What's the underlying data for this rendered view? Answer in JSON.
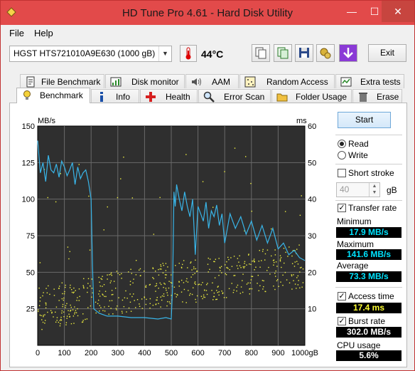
{
  "window": {
    "title": "HD Tune Pro 4.61 - Hard Disk Utility",
    "minimize": "—",
    "maximize": "☐",
    "close": "✕"
  },
  "menu": {
    "file": "File",
    "help": "Help"
  },
  "toolbar": {
    "drive": "HGST HTS721010A9E630 (1000 gB)",
    "temperature": "44°C",
    "exit_label": "Exit"
  },
  "tabs_top": [
    {
      "label": "File Benchmark",
      "icon": "file-benchmark-icon"
    },
    {
      "label": "Disk monitor",
      "icon": "disk-monitor-icon"
    },
    {
      "label": "AAM",
      "icon": "speaker-icon"
    },
    {
      "label": "Random Access",
      "icon": "random-access-icon"
    },
    {
      "label": "Extra tests",
      "icon": "extra-tests-icon"
    }
  ],
  "tabs_bottom": [
    {
      "label": "Benchmark",
      "icon": "bulb-icon",
      "active": true
    },
    {
      "label": "Info",
      "icon": "info-icon"
    },
    {
      "label": "Health",
      "icon": "health-cross-icon"
    },
    {
      "label": "Error Scan",
      "icon": "magnifier-icon"
    },
    {
      "label": "Folder Usage",
      "icon": "folder-icon"
    },
    {
      "label": "Erase",
      "icon": "trash-icon"
    }
  ],
  "controls": {
    "start_label": "Start",
    "read_label": "Read",
    "write_label": "Write",
    "read_selected": true,
    "short_stroke_label": "Short stroke",
    "short_stroke_checked": false,
    "short_stroke_value": "40",
    "short_stroke_unit": "gB",
    "transfer_rate_label": "Transfer rate",
    "transfer_rate_checked": true,
    "access_time_label": "Access time",
    "access_time_checked": true,
    "burst_rate_label": "Burst rate",
    "burst_rate_checked": true
  },
  "stats": {
    "minimum_label": "Minimum",
    "minimum_value": "17.9 MB/s",
    "maximum_label": "Maximum",
    "maximum_value": "141.6 MB/s",
    "average_label": "Average",
    "average_value": "73.3 MB/s",
    "access_time_value": "17.4 ms",
    "burst_rate_value": "302.0 MB/s",
    "cpu_label": "CPU usage",
    "cpu_value": "5.6%"
  },
  "colors": {
    "chart_bg": "#2f2f2f",
    "grid": "#6a6a6a",
    "transfer_line": "#39b5e8",
    "access_points": "#f0f040"
  },
  "chart_data": {
    "type": "line",
    "xlabel_unit": "gB",
    "left_axis_label": "MB/s",
    "right_axis_label": "ms",
    "xlim": [
      0,
      1000
    ],
    "ylim_left": [
      0,
      150
    ],
    "ylim_right": [
      0,
      60
    ],
    "x_ticks": [
      "0",
      "100",
      "200",
      "300",
      "400",
      "500",
      "600",
      "700",
      "800",
      "900",
      "1000gB"
    ],
    "y_ticks_left": [
      "150",
      "125",
      "100",
      "75",
      "50",
      "25"
    ],
    "y_ticks_right": [
      "60",
      "50",
      "40",
      "30",
      "20",
      "10"
    ],
    "grid": true,
    "series": [
      {
        "kind": "transfer_rate",
        "x": [
          0,
          10,
          20,
          30,
          40,
          50,
          60,
          70,
          80,
          90,
          100,
          110,
          120,
          130,
          140,
          150,
          160,
          170,
          180,
          190,
          195,
          200,
          205,
          210,
          230,
          260,
          300,
          350,
          400,
          450,
          480,
          500,
          505,
          510,
          515,
          520,
          530,
          540,
          550,
          560,
          570,
          580,
          590,
          600,
          610,
          620,
          630,
          640,
          650,
          660,
          670,
          680,
          690,
          700,
          720,
          740,
          760,
          780,
          800,
          820,
          840,
          860,
          880,
          900,
          920,
          940,
          960,
          980,
          1000
        ],
        "y": [
          140,
          118,
          125,
          112,
          130,
          120,
          118,
          124,
          115,
          126,
          122,
          116,
          120,
          125,
          110,
          122,
          114,
          118,
          120,
          112,
          106,
          100,
          55,
          25,
          22,
          20,
          20,
          19,
          19,
          18,
          19,
          18,
          40,
          105,
          95,
          110,
          100,
          92,
          105,
          95,
          88,
          100,
          62,
          95,
          90,
          85,
          98,
          80,
          92,
          88,
          96,
          82,
          90,
          70,
          90,
          80,
          88,
          76,
          85,
          72,
          82,
          70,
          80,
          66,
          70,
          62,
          65,
          60,
          58
        ]
      },
      {
        "kind": "access_time_points",
        "note_unit": "ms",
        "x_range": [
          0,
          1000
        ],
        "y_trend": [
          [
            0,
            10
          ],
          [
            200,
            13
          ],
          [
            400,
            16
          ],
          [
            600,
            18
          ],
          [
            800,
            20
          ],
          [
            1000,
            22
          ]
        ]
      }
    ]
  }
}
